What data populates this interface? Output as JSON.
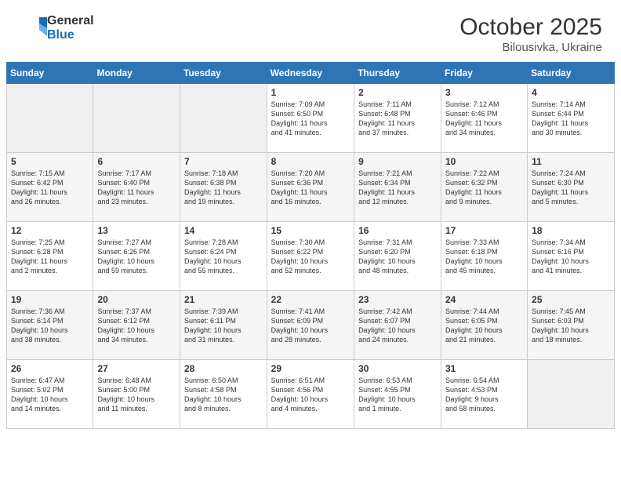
{
  "header": {
    "logo_general": "General",
    "logo_blue": "Blue",
    "month_year": "October 2025",
    "location": "Bilousivka, Ukraine"
  },
  "columns": [
    "Sunday",
    "Monday",
    "Tuesday",
    "Wednesday",
    "Thursday",
    "Friday",
    "Saturday"
  ],
  "weeks": [
    [
      {
        "day": "",
        "info": "",
        "empty": true
      },
      {
        "day": "",
        "info": "",
        "empty": true
      },
      {
        "day": "",
        "info": "",
        "empty": true
      },
      {
        "day": "1",
        "info": "Sunrise: 7:09 AM\nSunset: 6:50 PM\nDaylight: 11 hours\nand 41 minutes."
      },
      {
        "day": "2",
        "info": "Sunrise: 7:11 AM\nSunset: 6:48 PM\nDaylight: 11 hours\nand 37 minutes."
      },
      {
        "day": "3",
        "info": "Sunrise: 7:12 AM\nSunset: 6:46 PM\nDaylight: 11 hours\nand 34 minutes."
      },
      {
        "day": "4",
        "info": "Sunrise: 7:14 AM\nSunset: 6:44 PM\nDaylight: 11 hours\nand 30 minutes."
      }
    ],
    [
      {
        "day": "5",
        "info": "Sunrise: 7:15 AM\nSunset: 6:42 PM\nDaylight: 11 hours\nand 26 minutes."
      },
      {
        "day": "6",
        "info": "Sunrise: 7:17 AM\nSunset: 6:40 PM\nDaylight: 11 hours\nand 23 minutes."
      },
      {
        "day": "7",
        "info": "Sunrise: 7:18 AM\nSunset: 6:38 PM\nDaylight: 11 hours\nand 19 minutes."
      },
      {
        "day": "8",
        "info": "Sunrise: 7:20 AM\nSunset: 6:36 PM\nDaylight: 11 hours\nand 16 minutes."
      },
      {
        "day": "9",
        "info": "Sunrise: 7:21 AM\nSunset: 6:34 PM\nDaylight: 11 hours\nand 12 minutes."
      },
      {
        "day": "10",
        "info": "Sunrise: 7:22 AM\nSunset: 6:32 PM\nDaylight: 11 hours\nand 9 minutes."
      },
      {
        "day": "11",
        "info": "Sunrise: 7:24 AM\nSunset: 6:30 PM\nDaylight: 11 hours\nand 5 minutes."
      }
    ],
    [
      {
        "day": "12",
        "info": "Sunrise: 7:25 AM\nSunset: 6:28 PM\nDaylight: 11 hours\nand 2 minutes."
      },
      {
        "day": "13",
        "info": "Sunrise: 7:27 AM\nSunset: 6:26 PM\nDaylight: 10 hours\nand 59 minutes."
      },
      {
        "day": "14",
        "info": "Sunrise: 7:28 AM\nSunset: 6:24 PM\nDaylight: 10 hours\nand 55 minutes."
      },
      {
        "day": "15",
        "info": "Sunrise: 7:30 AM\nSunset: 6:22 PM\nDaylight: 10 hours\nand 52 minutes."
      },
      {
        "day": "16",
        "info": "Sunrise: 7:31 AM\nSunset: 6:20 PM\nDaylight: 10 hours\nand 48 minutes."
      },
      {
        "day": "17",
        "info": "Sunrise: 7:33 AM\nSunset: 6:18 PM\nDaylight: 10 hours\nand 45 minutes."
      },
      {
        "day": "18",
        "info": "Sunrise: 7:34 AM\nSunset: 6:16 PM\nDaylight: 10 hours\nand 41 minutes."
      }
    ],
    [
      {
        "day": "19",
        "info": "Sunrise: 7:36 AM\nSunset: 6:14 PM\nDaylight: 10 hours\nand 38 minutes."
      },
      {
        "day": "20",
        "info": "Sunrise: 7:37 AM\nSunset: 6:12 PM\nDaylight: 10 hours\nand 34 minutes."
      },
      {
        "day": "21",
        "info": "Sunrise: 7:39 AM\nSunset: 6:11 PM\nDaylight: 10 hours\nand 31 minutes."
      },
      {
        "day": "22",
        "info": "Sunrise: 7:41 AM\nSunset: 6:09 PM\nDaylight: 10 hours\nand 28 minutes."
      },
      {
        "day": "23",
        "info": "Sunrise: 7:42 AM\nSunset: 6:07 PM\nDaylight: 10 hours\nand 24 minutes."
      },
      {
        "day": "24",
        "info": "Sunrise: 7:44 AM\nSunset: 6:05 PM\nDaylight: 10 hours\nand 21 minutes."
      },
      {
        "day": "25",
        "info": "Sunrise: 7:45 AM\nSunset: 6:03 PM\nDaylight: 10 hours\nand 18 minutes."
      }
    ],
    [
      {
        "day": "26",
        "info": "Sunrise: 6:47 AM\nSunset: 5:02 PM\nDaylight: 10 hours\nand 14 minutes."
      },
      {
        "day": "27",
        "info": "Sunrise: 6:48 AM\nSunset: 5:00 PM\nDaylight: 10 hours\nand 11 minutes."
      },
      {
        "day": "28",
        "info": "Sunrise: 6:50 AM\nSunset: 4:58 PM\nDaylight: 10 hours\nand 8 minutes."
      },
      {
        "day": "29",
        "info": "Sunrise: 6:51 AM\nSunset: 4:56 PM\nDaylight: 10 hours\nand 4 minutes."
      },
      {
        "day": "30",
        "info": "Sunrise: 6:53 AM\nSunset: 4:55 PM\nDaylight: 10 hours\nand 1 minute."
      },
      {
        "day": "31",
        "info": "Sunrise: 6:54 AM\nSunset: 4:53 PM\nDaylight: 9 hours\nand 58 minutes."
      },
      {
        "day": "",
        "info": "",
        "empty": true
      }
    ]
  ]
}
